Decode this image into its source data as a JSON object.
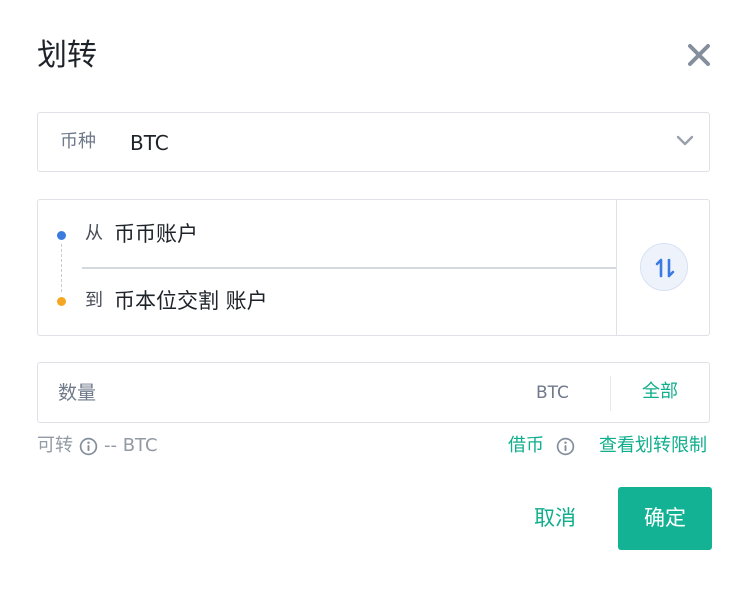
{
  "dialog": {
    "title": "划转"
  },
  "currency": {
    "label": "币种",
    "value": "BTC"
  },
  "transfer": {
    "from_label": "从",
    "from_account": "币币账户",
    "to_label": "到",
    "to_account": "币本位交割 账户"
  },
  "amount": {
    "placeholder": "数量",
    "value": "",
    "unit": "BTC",
    "all_label": "全部"
  },
  "available": {
    "label": "可转",
    "value": "-- BTC"
  },
  "links": {
    "borrow": "借币",
    "view_limits": "查看划转限制"
  },
  "actions": {
    "cancel": "取消",
    "confirm": "确定"
  },
  "icons": {
    "close": "close-icon",
    "dropdown": "chevron-down-icon",
    "swap": "swap-vertical-icon",
    "info": "info-icon"
  },
  "colors": {
    "accent": "#0fae8c",
    "confirm_bg": "#14b294",
    "from_dot": "#3b7be0",
    "to_dot": "#f5a623",
    "swap_icon": "#3b7be0"
  }
}
